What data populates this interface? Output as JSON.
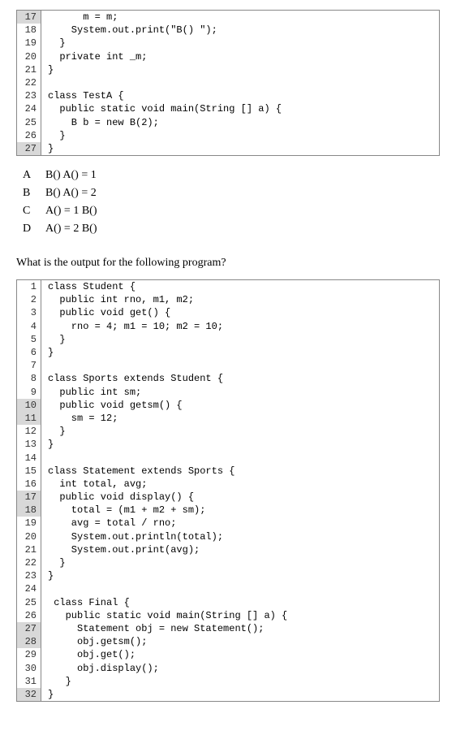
{
  "code1": {
    "lines": [
      {
        "n": 17,
        "hl": true,
        "t": "      m = m;"
      },
      {
        "n": 18,
        "hl": false,
        "t": "    System.out.print(\"B() \");"
      },
      {
        "n": 19,
        "hl": false,
        "t": "  }"
      },
      {
        "n": 20,
        "hl": false,
        "t": "  private int _m;"
      },
      {
        "n": 21,
        "hl": false,
        "t": "}"
      },
      {
        "n": 22,
        "hl": false,
        "t": ""
      },
      {
        "n": 23,
        "hl": false,
        "t": "class TestA {"
      },
      {
        "n": 24,
        "hl": false,
        "t": "  public static void main(String [] a) {"
      },
      {
        "n": 25,
        "hl": false,
        "t": "    B b = new B(2);"
      },
      {
        "n": 26,
        "hl": false,
        "t": "  }"
      },
      {
        "n": 27,
        "hl": true,
        "t": "}"
      }
    ]
  },
  "options": [
    {
      "letter": "A",
      "text": "B() A() = 1"
    },
    {
      "letter": "B",
      "text": "B() A() = 2"
    },
    {
      "letter": "C",
      "text": "A() = 1 B()"
    },
    {
      "letter": "D",
      "text": "A() = 2 B()"
    }
  ],
  "question": "What is the output for the following program?",
  "code2": {
    "lines": [
      {
        "n": 1,
        "hl": false,
        "t": "class Student {"
      },
      {
        "n": 2,
        "hl": false,
        "t": "  public int rno, m1, m2;"
      },
      {
        "n": 3,
        "hl": false,
        "t": "  public void get() {"
      },
      {
        "n": 4,
        "hl": false,
        "t": "    rno = 4; m1 = 10; m2 = 10;"
      },
      {
        "n": 5,
        "hl": false,
        "t": "  }"
      },
      {
        "n": 6,
        "hl": false,
        "t": "}"
      },
      {
        "n": 7,
        "hl": false,
        "t": ""
      },
      {
        "n": 8,
        "hl": false,
        "t": "class Sports extends Student {"
      },
      {
        "n": 9,
        "hl": false,
        "t": "  public int sm;"
      },
      {
        "n": 10,
        "hl": true,
        "t": "  public void getsm() {"
      },
      {
        "n": 11,
        "hl": true,
        "t": "    sm = 12;"
      },
      {
        "n": 12,
        "hl": false,
        "t": "  }"
      },
      {
        "n": 13,
        "hl": false,
        "t": "}"
      },
      {
        "n": 14,
        "hl": false,
        "t": ""
      },
      {
        "n": 15,
        "hl": false,
        "t": "class Statement extends Sports {"
      },
      {
        "n": 16,
        "hl": false,
        "t": "  int total, avg;"
      },
      {
        "n": 17,
        "hl": true,
        "t": "  public void display() {"
      },
      {
        "n": 18,
        "hl": true,
        "t": "    total = (m1 + m2 + sm);"
      },
      {
        "n": 19,
        "hl": false,
        "t": "    avg = total / rno;"
      },
      {
        "n": 20,
        "hl": false,
        "t": "    System.out.println(total);"
      },
      {
        "n": 21,
        "hl": false,
        "t": "    System.out.print(avg);"
      },
      {
        "n": 22,
        "hl": false,
        "t": "  }"
      },
      {
        "n": 23,
        "hl": false,
        "t": "}"
      },
      {
        "n": 24,
        "hl": false,
        "t": ""
      },
      {
        "n": 25,
        "hl": false,
        "t": " class Final {"
      },
      {
        "n": 26,
        "hl": false,
        "t": "   public static void main(String [] a) {"
      },
      {
        "n": 27,
        "hl": true,
        "t": "     Statement obj = new Statement();"
      },
      {
        "n": 28,
        "hl": true,
        "t": "     obj.getsm();"
      },
      {
        "n": 29,
        "hl": false,
        "t": "     obj.get();"
      },
      {
        "n": 30,
        "hl": false,
        "t": "     obj.display();"
      },
      {
        "n": 31,
        "hl": false,
        "t": "   }"
      },
      {
        "n": 32,
        "hl": true,
        "t": "}"
      }
    ]
  }
}
